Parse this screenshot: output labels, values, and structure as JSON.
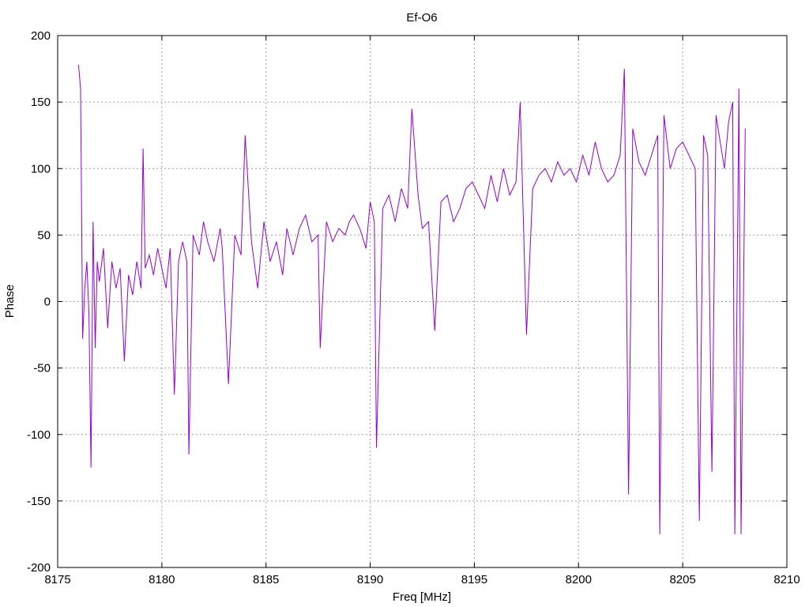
{
  "chart_data": {
    "type": "line",
    "title": "Ef-O6",
    "xlabel": "Freq [MHz]",
    "ylabel": "Phase",
    "xlim": [
      8175,
      8210
    ],
    "ylim": [
      -200,
      200
    ],
    "x_ticks": [
      "8175",
      "8180",
      "8185",
      "8190",
      "8195",
      "8200",
      "8205",
      "8210"
    ],
    "y_ticks": [
      "200",
      "150",
      "100",
      "50",
      "0",
      "-50",
      "-100",
      "-150",
      "-200"
    ],
    "grid": true,
    "legend": "none",
    "series": [
      {
        "color": "#9400d3",
        "x": [
          8176.0,
          8176.1,
          8176.2,
          8176.3,
          8176.4,
          8176.5,
          8176.6,
          8176.7,
          8176.8,
          8176.9,
          8177.0,
          8177.2,
          8177.4,
          8177.6,
          8177.8,
          8178.0,
          8178.2,
          8178.4,
          8178.6,
          8178.8,
          8179.0,
          8179.1,
          8179.2,
          8179.4,
          8179.6,
          8179.8,
          8180.0,
          8180.2,
          8180.4,
          8180.6,
          8180.8,
          8181.0,
          8181.2,
          8181.3,
          8181.5,
          8181.8,
          8182.0,
          8182.2,
          8182.5,
          8182.8,
          8182.9,
          8183.2,
          8183.5,
          8183.8,
          8184.0,
          8184.3,
          8184.6,
          8184.9,
          8185.2,
          8185.5,
          8185.8,
          8186.0,
          8186.3,
          8186.6,
          8186.9,
          8187.2,
          8187.5,
          8187.6,
          8187.9,
          8188.2,
          8188.5,
          8188.8,
          8189.0,
          8189.2,
          8189.5,
          8189.8,
          8190.0,
          8190.2,
          8190.3,
          8190.6,
          8190.9,
          8191.2,
          8191.5,
          8191.8,
          8192.0,
          8192.3,
          8192.5,
          8192.8,
          8193.1,
          8193.4,
          8193.7,
          8194.0,
          8194.3,
          8194.6,
          8194.9,
          8195.2,
          8195.5,
          8195.8,
          8196.1,
          8196.4,
          8196.7,
          8197.0,
          8197.2,
          8197.5,
          8197.8,
          8198.1,
          8198.4,
          8198.7,
          8199.0,
          8199.3,
          8199.6,
          8199.9,
          8200.2,
          8200.5,
          8200.8,
          8201.1,
          8201.4,
          8201.7,
          8202.0,
          8202.2,
          8202.4,
          8202.6,
          8202.9,
          8203.2,
          8203.5,
          8203.8,
          8203.9,
          8204.1,
          8204.4,
          8204.7,
          8205.0,
          8205.3,
          8205.6,
          8205.8,
          8206.0,
          8206.2,
          8206.4,
          8206.6,
          8206.8,
          8207.0,
          8207.2,
          8207.4,
          8207.5,
          8207.7,
          8207.8,
          8208.0
        ],
        "y": [
          178,
          160,
          -28,
          10,
          30,
          -10,
          -125,
          60,
          -35,
          30,
          15,
          40,
          -20,
          30,
          10,
          25,
          -45,
          20,
          5,
          30,
          10,
          115,
          25,
          35,
          20,
          40,
          25,
          10,
          40,
          -70,
          30,
          45,
          30,
          -115,
          50,
          35,
          60,
          45,
          30,
          55,
          40,
          -62,
          50,
          35,
          125,
          45,
          10,
          60,
          30,
          45,
          20,
          55,
          35,
          55,
          65,
          45,
          50,
          -35,
          60,
          45,
          55,
          50,
          60,
          65,
          55,
          40,
          75,
          60,
          -110,
          70,
          80,
          60,
          85,
          70,
          145,
          80,
          55,
          60,
          -22,
          75,
          80,
          60,
          70,
          85,
          90,
          80,
          70,
          95,
          75,
          100,
          80,
          90,
          150,
          -25,
          85,
          95,
          100,
          90,
          105,
          95,
          100,
          90,
          110,
          95,
          120,
          100,
          90,
          95,
          110,
          175,
          -145,
          130,
          105,
          95,
          110,
          125,
          -175,
          140,
          100,
          115,
          120,
          110,
          100,
          -165,
          125,
          110,
          -128,
          140,
          120,
          100,
          135,
          150,
          -175,
          160,
          -175,
          130
        ]
      }
    ]
  }
}
